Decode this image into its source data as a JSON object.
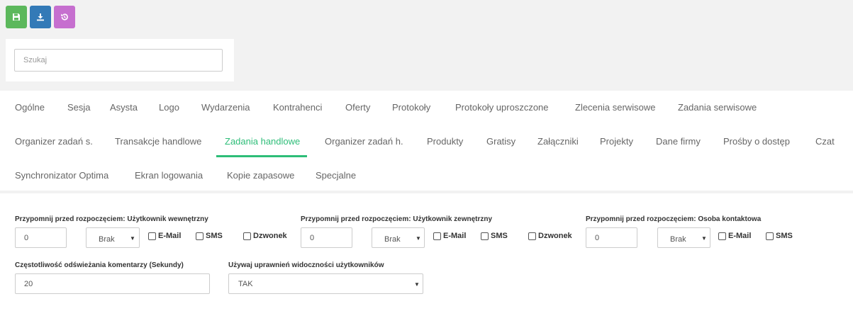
{
  "toolbar": {
    "buttons": [
      {
        "name": "save-button",
        "icon": "floppy-icon",
        "color": "#5cb85c"
      },
      {
        "name": "download-button",
        "icon": "download-icon",
        "color": "#337ab7"
      },
      {
        "name": "restore-button",
        "icon": "restore-icon",
        "color": "#c66fcf"
      }
    ]
  },
  "search": {
    "placeholder": "Szukaj"
  },
  "tabs": {
    "row1": [
      "Ogólne",
      "Sesja",
      "Asysta",
      "Logo",
      "Wydarzenia",
      "Kontrahenci",
      "Oferty",
      "Protokoły",
      "Protokoły uproszczone",
      "Zlecenia serwisowe",
      "Zadania serwisowe"
    ],
    "row2": [
      "Organizer zadań s.",
      "Transakcje handlowe",
      "Zadania handlowe",
      "Organizer zadań h.",
      "Produkty",
      "Gratisy",
      "Załączniki",
      "Projekty",
      "Dane firmy",
      "Prośby o dostęp",
      "Czat"
    ],
    "row3": [
      "Synchronizator Optima",
      "Ekran logowania",
      "Kopie zapasowe",
      "Specjalne"
    ],
    "active": "Zadania handlowe",
    "active_color": "#2dbd78"
  },
  "reminders": [
    {
      "label": "Przypomnij przed rozpoczęciem: Użytkownik wewnętrzny",
      "value": "0",
      "unit": "Brak",
      "email": "E-Mail",
      "sms": "SMS",
      "call": "Dzwonek"
    },
    {
      "label": "Przypomnij przed rozpoczęciem: Użytkownik zewnętrzny",
      "value": "0",
      "unit": "Brak",
      "email": "E-Mail",
      "sms": "SMS",
      "call": "Dzwonek"
    },
    {
      "label": "Przypomnij przed rozpoczęciem: Osoba kontaktowa",
      "value": "0",
      "unit": "Brak",
      "email": "E-Mail",
      "sms": "SMS"
    }
  ],
  "refresh": {
    "label": "Częstotliwość odświeżania komentarzy (Sekundy)",
    "value": "20"
  },
  "visibility": {
    "label": "Używaj uprawnień widoczności użytkowników",
    "value": "TAK"
  }
}
